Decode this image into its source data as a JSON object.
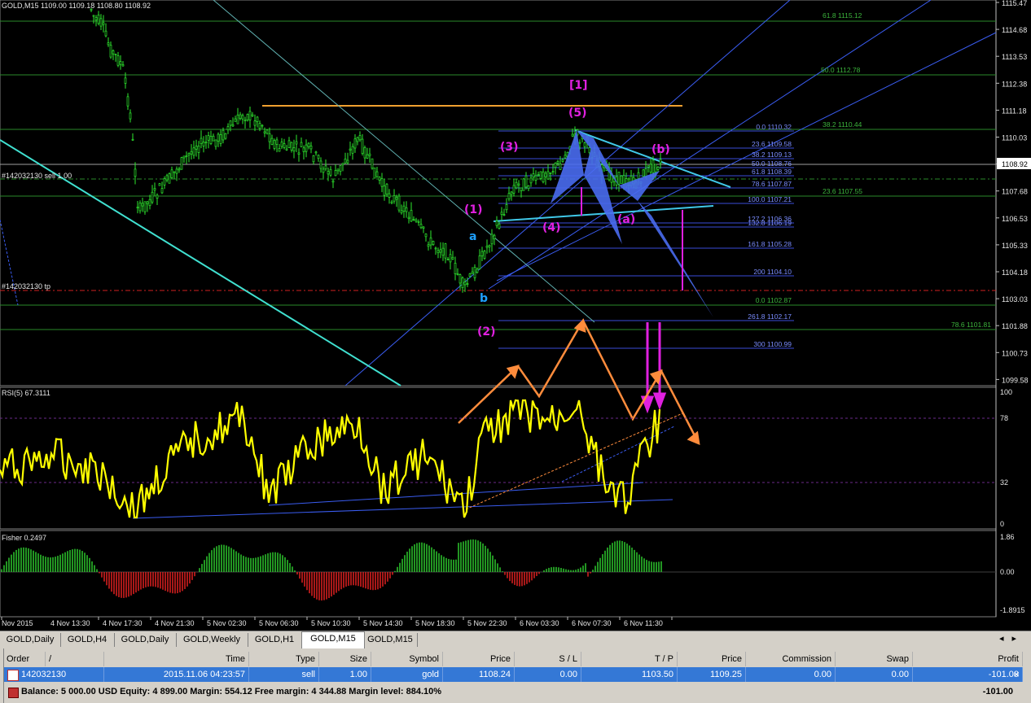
{
  "main_chart": {
    "title": "GOLD,M15  1109.00 1109.18 1108.80 1108.92",
    "order_line_label": "#142032130 sell 1.00",
    "tp_line_label": "#142032130 tp",
    "current_price": "1108.92",
    "price_axis": [
      "1115.47",
      "1114.68",
      "1113.53",
      "1112.38",
      "1111.18",
      "1110.03",
      "1108.92",
      "1107.68",
      "1106.53",
      "1105.33",
      "1104.18",
      "1103.03",
      "1101.88",
      "1100.73",
      "1099.58"
    ],
    "fib_right": [
      {
        "text": "61.8 1115.12",
        "color": "#3cb43c"
      },
      {
        "text": "50.0 1112.78",
        "color": "#3cb43c"
      },
      {
        "text": "38.2 1110.44",
        "color": "#3cb43c"
      },
      {
        "text": "23.6 1107.55",
        "color": "#3cb43c"
      },
      {
        "text": "78.6 1101.81",
        "color": "#3cb43c"
      }
    ],
    "fib_mid": [
      {
        "text": "0.0 1110.32",
        "color": "#7a8cff"
      },
      {
        "text": "23.6 1109.58",
        "color": "#7a8cff"
      },
      {
        "text": "38.2 1109.13",
        "color": "#7a8cff"
      },
      {
        "text": "50.0 1108.76",
        "color": "#7a8cff"
      },
      {
        "text": "61.8 1108.39",
        "color": "#7a8cff"
      },
      {
        "text": "78.6 1107.87",
        "color": "#7a8cff"
      },
      {
        "text": "100.0 1107.21",
        "color": "#7a8cff"
      },
      {
        "text": "127.2 1106.36",
        "color": "#7a8cff"
      },
      {
        "text": "132.8 1106.19",
        "color": "#7a8cff"
      },
      {
        "text": "161.8 1105.28",
        "color": "#7a8cff"
      },
      {
        "text": "200 1104.10",
        "color": "#7a8cff"
      },
      {
        "text": "0.0 1102.87",
        "color": "#3cb43c"
      },
      {
        "text": "261.8 1102.17",
        "color": "#7a8cff"
      },
      {
        "text": "300 1100.99",
        "color": "#7a8cff"
      }
    ],
    "wave_labels": [
      {
        "text": "[1]",
        "color": "#e020e0"
      },
      {
        "text": "(5)",
        "color": "#e020e0"
      },
      {
        "text": "(3)",
        "color": "#e020e0"
      },
      {
        "text": "(b)",
        "color": "#e020e0"
      },
      {
        "text": "(1)",
        "color": "#e020e0"
      },
      {
        "text": "(4)",
        "color": "#e020e0"
      },
      {
        "text": "(a)",
        "color": "#e020e0"
      },
      {
        "text": "a",
        "color": "#1ea0ff"
      },
      {
        "text": "b",
        "color": "#1ea0ff"
      },
      {
        "text": "(2)",
        "color": "#e020e0"
      }
    ]
  },
  "rsi": {
    "title": "RSI(5) 67.3111",
    "levels": [
      "100",
      "78",
      "32",
      "0"
    ]
  },
  "fisher": {
    "title": "Fisher 0.2497",
    "levels": [
      "1.86",
      "0.00",
      "-1.8915"
    ]
  },
  "time_axis": [
    "Nov 2015",
    "4 Nov 13:30",
    "4 Nov 17:30",
    "4 Nov 21:30",
    "5 Nov 02:30",
    "5 Nov 06:30",
    "5 Nov 10:30",
    "5 Nov 14:30",
    "5 Nov 18:30",
    "5 Nov 22:30",
    "6 Nov 03:30",
    "6 Nov 07:30",
    "6 Nov 11:30"
  ],
  "tabs": [
    "GOLD,Daily",
    "GOLD,H4",
    "GOLD,Daily",
    "GOLD,Weekly",
    "GOLD,H1",
    "GOLD,M15",
    "GOLD,M15"
  ],
  "active_tab_index": 5,
  "terminal": {
    "headers": [
      "Order",
      "/",
      "Time",
      "Type",
      "Size",
      "Symbol",
      "Price",
      "S / L",
      "T / P",
      "Price",
      "Commission",
      "Swap",
      "Profit"
    ],
    "row": [
      "142032130",
      "2015.11.06 04:23:57",
      "sell",
      "1.00",
      "gold",
      "1108.24",
      "0.00",
      "1103.50",
      "1109.25",
      "0.00",
      "0.00",
      "-101.00"
    ],
    "balance": "Balance: 5 000.00 USD  Equity: 4 899.00  Margin: 554.12  Free margin: 4 344.88  Margin level: 884.10%",
    "balance_profit": "-101.00"
  },
  "colors": {
    "candles": "#2ee82e",
    "rsi_line": "#ffff00",
    "orange": "#ff8c3c",
    "magenta": "#e020e0",
    "blue_shape": "#4a6cf0",
    "cyan_line": "#40e0d0"
  }
}
